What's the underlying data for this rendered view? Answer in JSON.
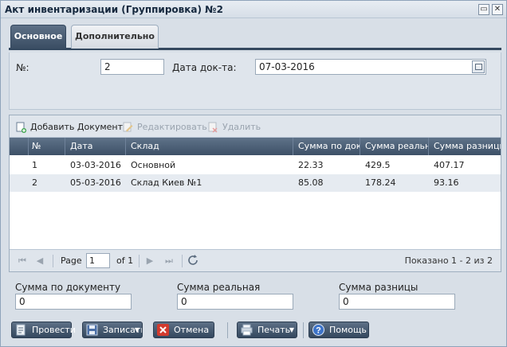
{
  "window": {
    "title": "Акт инвентаризации (Группировка) №2",
    "restore_glyph": "▭",
    "close_glyph": "✕"
  },
  "tabs": [
    {
      "label": "Основное",
      "active": true
    },
    {
      "label": "Дополнительно",
      "active": false
    }
  ],
  "form": {
    "number_label": "№:",
    "number_value": "2",
    "date_label": "Дата док-та:",
    "date_value": "07-03-2016"
  },
  "grid": {
    "toolbar": {
      "add": "Добавить Документ",
      "edit": "Редактировать",
      "delete": "Удалить"
    },
    "columns": [
      "№",
      "Дата",
      "Склад",
      "Сумма по докум",
      "Сумма реальна",
      "Сумма разницы"
    ],
    "rows": [
      [
        "1",
        "03-03-2016",
        "Основной",
        "22.33",
        "429.5",
        "407.17"
      ],
      [
        "2",
        "05-03-2016",
        "Склад Киев №1",
        "85.08",
        "178.24",
        "93.16"
      ]
    ],
    "pager": {
      "page_label": "Page",
      "page_value": "1",
      "of_label": "of 1",
      "summary": "Показано 1 - 2 из 2"
    }
  },
  "totals": {
    "doc_label": "Сумма по документу",
    "doc_value": "0",
    "real_label": "Сумма реальная",
    "real_value": "0",
    "diff_label": "Сумма разницы",
    "diff_value": "0"
  },
  "buttons": {
    "post": "Провести",
    "save": "Записать",
    "cancel": "Отмена",
    "print": "Печать",
    "help": "Помощь"
  },
  "colors": {
    "accent": "#3a4d63",
    "header_bg": "#4d6179",
    "row_alt": "#e6ebf1"
  }
}
